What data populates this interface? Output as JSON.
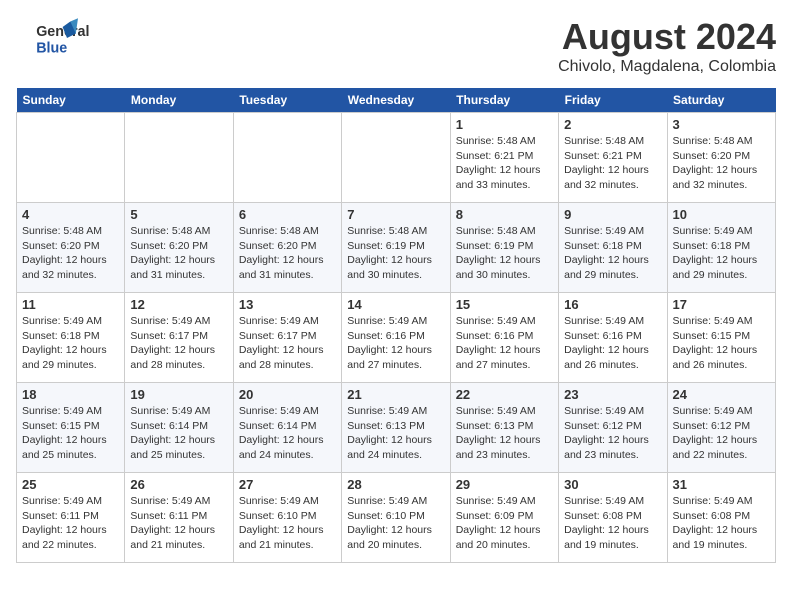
{
  "header": {
    "logo_line1": "General",
    "logo_line2": "Blue",
    "month_year": "August 2024",
    "location": "Chivolo, Magdalena, Colombia"
  },
  "weekdays": [
    "Sunday",
    "Monday",
    "Tuesday",
    "Wednesday",
    "Thursday",
    "Friday",
    "Saturday"
  ],
  "weeks": [
    [
      {
        "day": "",
        "info": ""
      },
      {
        "day": "",
        "info": ""
      },
      {
        "day": "",
        "info": ""
      },
      {
        "day": "",
        "info": ""
      },
      {
        "day": "1",
        "info": "Sunrise: 5:48 AM\nSunset: 6:21 PM\nDaylight: 12 hours\nand 33 minutes."
      },
      {
        "day": "2",
        "info": "Sunrise: 5:48 AM\nSunset: 6:21 PM\nDaylight: 12 hours\nand 32 minutes."
      },
      {
        "day": "3",
        "info": "Sunrise: 5:48 AM\nSunset: 6:20 PM\nDaylight: 12 hours\nand 32 minutes."
      }
    ],
    [
      {
        "day": "4",
        "info": "Sunrise: 5:48 AM\nSunset: 6:20 PM\nDaylight: 12 hours\nand 32 minutes."
      },
      {
        "day": "5",
        "info": "Sunrise: 5:48 AM\nSunset: 6:20 PM\nDaylight: 12 hours\nand 31 minutes."
      },
      {
        "day": "6",
        "info": "Sunrise: 5:48 AM\nSunset: 6:20 PM\nDaylight: 12 hours\nand 31 minutes."
      },
      {
        "day": "7",
        "info": "Sunrise: 5:48 AM\nSunset: 6:19 PM\nDaylight: 12 hours\nand 30 minutes."
      },
      {
        "day": "8",
        "info": "Sunrise: 5:48 AM\nSunset: 6:19 PM\nDaylight: 12 hours\nand 30 minutes."
      },
      {
        "day": "9",
        "info": "Sunrise: 5:49 AM\nSunset: 6:18 PM\nDaylight: 12 hours\nand 29 minutes."
      },
      {
        "day": "10",
        "info": "Sunrise: 5:49 AM\nSunset: 6:18 PM\nDaylight: 12 hours\nand 29 minutes."
      }
    ],
    [
      {
        "day": "11",
        "info": "Sunrise: 5:49 AM\nSunset: 6:18 PM\nDaylight: 12 hours\nand 29 minutes."
      },
      {
        "day": "12",
        "info": "Sunrise: 5:49 AM\nSunset: 6:17 PM\nDaylight: 12 hours\nand 28 minutes."
      },
      {
        "day": "13",
        "info": "Sunrise: 5:49 AM\nSunset: 6:17 PM\nDaylight: 12 hours\nand 28 minutes."
      },
      {
        "day": "14",
        "info": "Sunrise: 5:49 AM\nSunset: 6:16 PM\nDaylight: 12 hours\nand 27 minutes."
      },
      {
        "day": "15",
        "info": "Sunrise: 5:49 AM\nSunset: 6:16 PM\nDaylight: 12 hours\nand 27 minutes."
      },
      {
        "day": "16",
        "info": "Sunrise: 5:49 AM\nSunset: 6:16 PM\nDaylight: 12 hours\nand 26 minutes."
      },
      {
        "day": "17",
        "info": "Sunrise: 5:49 AM\nSunset: 6:15 PM\nDaylight: 12 hours\nand 26 minutes."
      }
    ],
    [
      {
        "day": "18",
        "info": "Sunrise: 5:49 AM\nSunset: 6:15 PM\nDaylight: 12 hours\nand 25 minutes."
      },
      {
        "day": "19",
        "info": "Sunrise: 5:49 AM\nSunset: 6:14 PM\nDaylight: 12 hours\nand 25 minutes."
      },
      {
        "day": "20",
        "info": "Sunrise: 5:49 AM\nSunset: 6:14 PM\nDaylight: 12 hours\nand 24 minutes."
      },
      {
        "day": "21",
        "info": "Sunrise: 5:49 AM\nSunset: 6:13 PM\nDaylight: 12 hours\nand 24 minutes."
      },
      {
        "day": "22",
        "info": "Sunrise: 5:49 AM\nSunset: 6:13 PM\nDaylight: 12 hours\nand 23 minutes."
      },
      {
        "day": "23",
        "info": "Sunrise: 5:49 AM\nSunset: 6:12 PM\nDaylight: 12 hours\nand 23 minutes."
      },
      {
        "day": "24",
        "info": "Sunrise: 5:49 AM\nSunset: 6:12 PM\nDaylight: 12 hours\nand 22 minutes."
      }
    ],
    [
      {
        "day": "25",
        "info": "Sunrise: 5:49 AM\nSunset: 6:11 PM\nDaylight: 12 hours\nand 22 minutes."
      },
      {
        "day": "26",
        "info": "Sunrise: 5:49 AM\nSunset: 6:11 PM\nDaylight: 12 hours\nand 21 minutes."
      },
      {
        "day": "27",
        "info": "Sunrise: 5:49 AM\nSunset: 6:10 PM\nDaylight: 12 hours\nand 21 minutes."
      },
      {
        "day": "28",
        "info": "Sunrise: 5:49 AM\nSunset: 6:10 PM\nDaylight: 12 hours\nand 20 minutes."
      },
      {
        "day": "29",
        "info": "Sunrise: 5:49 AM\nSunset: 6:09 PM\nDaylight: 12 hours\nand 20 minutes."
      },
      {
        "day": "30",
        "info": "Sunrise: 5:49 AM\nSunset: 6:08 PM\nDaylight: 12 hours\nand 19 minutes."
      },
      {
        "day": "31",
        "info": "Sunrise: 5:49 AM\nSunset: 6:08 PM\nDaylight: 12 hours\nand 19 minutes."
      }
    ]
  ]
}
